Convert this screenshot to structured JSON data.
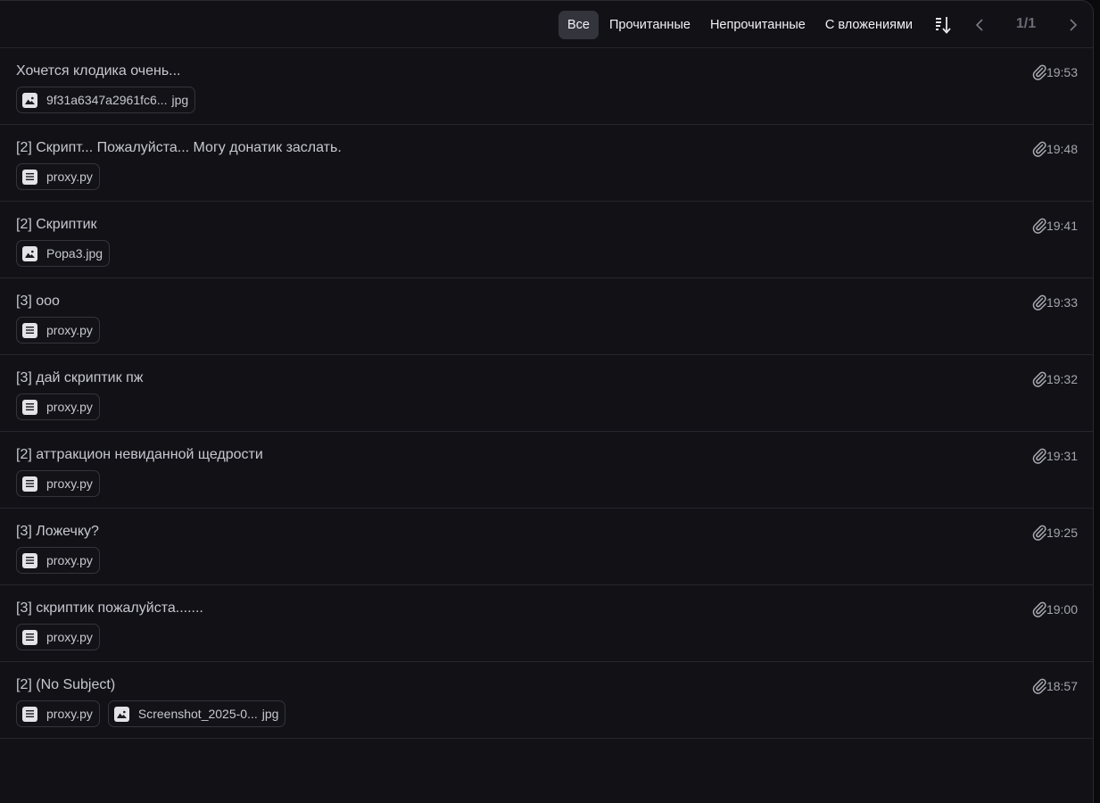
{
  "toolbar": {
    "filters": [
      "Все",
      "Прочитанные",
      "Непрочитанные",
      "С вложениями"
    ],
    "active_filter": "Все",
    "sort_icon": "sort-descending-icon",
    "page_indicator": "1/1"
  },
  "messages": [
    {
      "subject": "Хочется клодика очень...",
      "time": "19:53",
      "attachments": [
        {
          "type": "image",
          "name": "9f31a6347a2961fc6...",
          "ext": "jpg"
        }
      ]
    },
    {
      "subject": "[2] Скрипт... Пожалуйста... Могу донатик заслать.",
      "time": "19:48",
      "attachments": [
        {
          "type": "file",
          "name": "proxy.py"
        }
      ]
    },
    {
      "subject": "[2] Скриптик",
      "time": "19:41",
      "attachments": [
        {
          "type": "image",
          "name": "Popa3.jpg"
        }
      ]
    },
    {
      "subject": "[3] ооо",
      "time": "19:33",
      "attachments": [
        {
          "type": "file",
          "name": "proxy.py"
        }
      ]
    },
    {
      "subject": "[3] дай скриптик пж",
      "time": "19:32",
      "attachments": [
        {
          "type": "file",
          "name": "proxy.py"
        }
      ]
    },
    {
      "subject": "[2] аттракцион невиданной щедрости",
      "time": "19:31",
      "attachments": [
        {
          "type": "file",
          "name": "proxy.py"
        }
      ]
    },
    {
      "subject": "[3] Ложечку?",
      "time": "19:25",
      "attachments": [
        {
          "type": "file",
          "name": "proxy.py"
        }
      ]
    },
    {
      "subject": "[3] скриптик пожалуйста.......",
      "time": "19:00",
      "attachments": [
        {
          "type": "file",
          "name": "proxy.py"
        }
      ]
    },
    {
      "subject": "[2] (No Subject)",
      "time": "18:57",
      "attachments": [
        {
          "type": "file",
          "name": "proxy.py"
        },
        {
          "type": "image",
          "name": "Screenshot_2025-0...",
          "ext": "jpg"
        }
      ]
    }
  ],
  "colors": {
    "background": "#111116",
    "active_filter_bg": "#34343d",
    "divider": "#26262c"
  }
}
